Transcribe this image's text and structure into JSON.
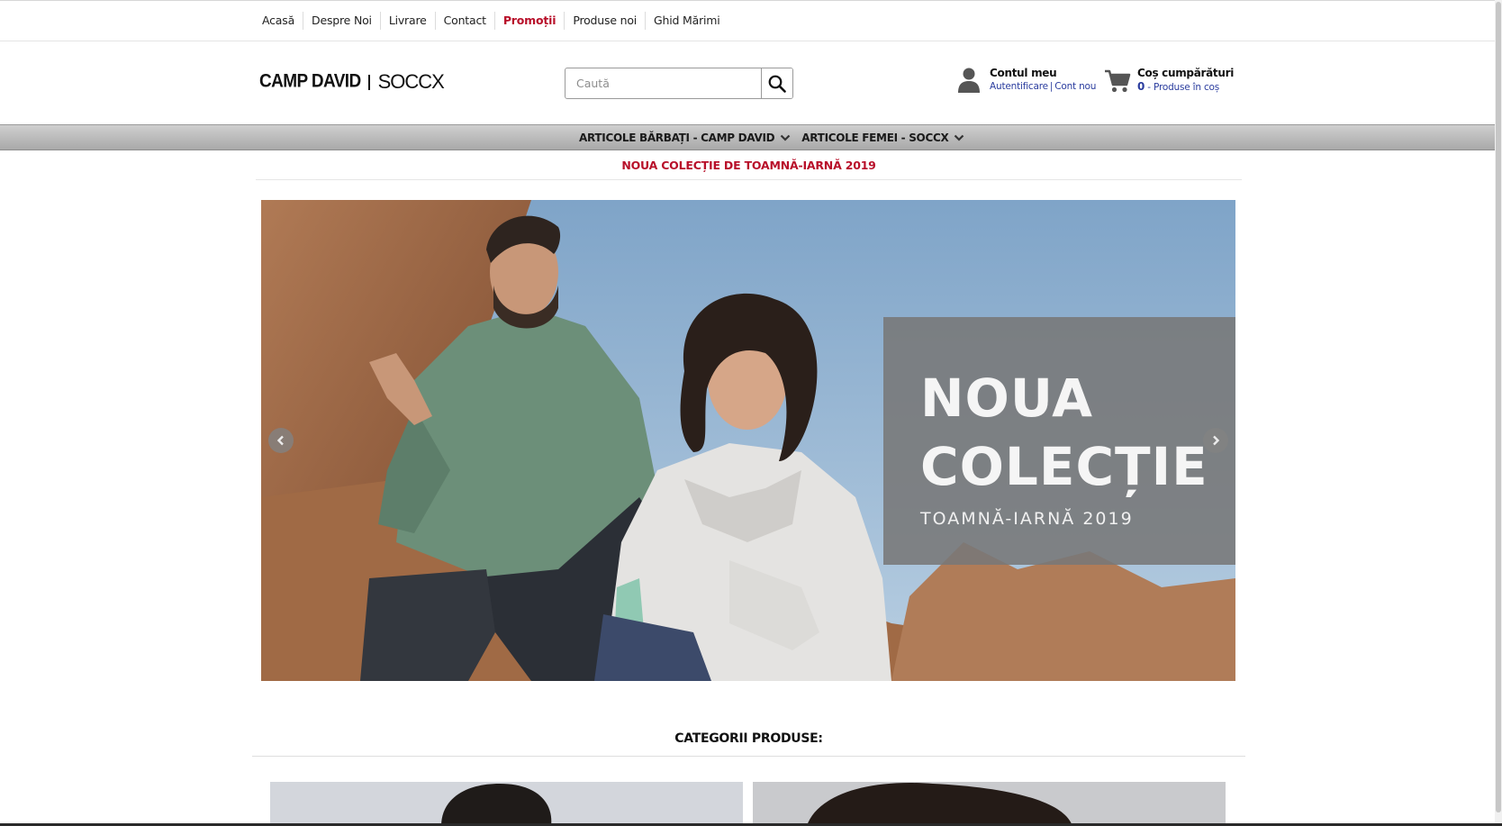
{
  "topnav": {
    "items": [
      {
        "label": "Acasă"
      },
      {
        "label": "Despre Noi"
      },
      {
        "label": "Livrare"
      },
      {
        "label": "Contact"
      },
      {
        "label": "Promoții"
      },
      {
        "label": "Produse noi"
      },
      {
        "label": "Ghid Mărimi"
      }
    ]
  },
  "header": {
    "logo_part1": "CAMP DAVID",
    "logo_part2": "SOCCX",
    "search_placeholder": "Caută",
    "account": {
      "title": "Contul meu",
      "login": "Autentificare",
      "separator": "|",
      "register": "Cont nou"
    },
    "cart": {
      "title": "Coș cumpărături",
      "count": "0",
      "dash": " - ",
      "label": "Produse în coș"
    }
  },
  "catmenu": {
    "men": "ARTICOLE BĂRBAȚI - CAMP DAVID",
    "women": "ARTICOLE FEMEI - SOCCX"
  },
  "promo": {
    "text": "NOUA COLECȚIE DE TOAMNĂ-IARNĂ 2019"
  },
  "hero": {
    "title_line1": "NOUA",
    "title_line2": "COLECȚIE",
    "subtitle": "TOAMNĂ-IARNĂ 2019"
  },
  "categories": {
    "title": "CATEGORII PRODUSE:"
  },
  "colors": {
    "accent_red": "#b8102a",
    "link_blue": "#2a3c9e",
    "menu_gray": "#b4b4b4"
  },
  "icons": {
    "search": "search-icon",
    "account": "user-icon",
    "cart": "cart-icon",
    "chevron": "chevron-down-icon",
    "prev": "chevron-left-icon",
    "next": "chevron-right-icon"
  }
}
